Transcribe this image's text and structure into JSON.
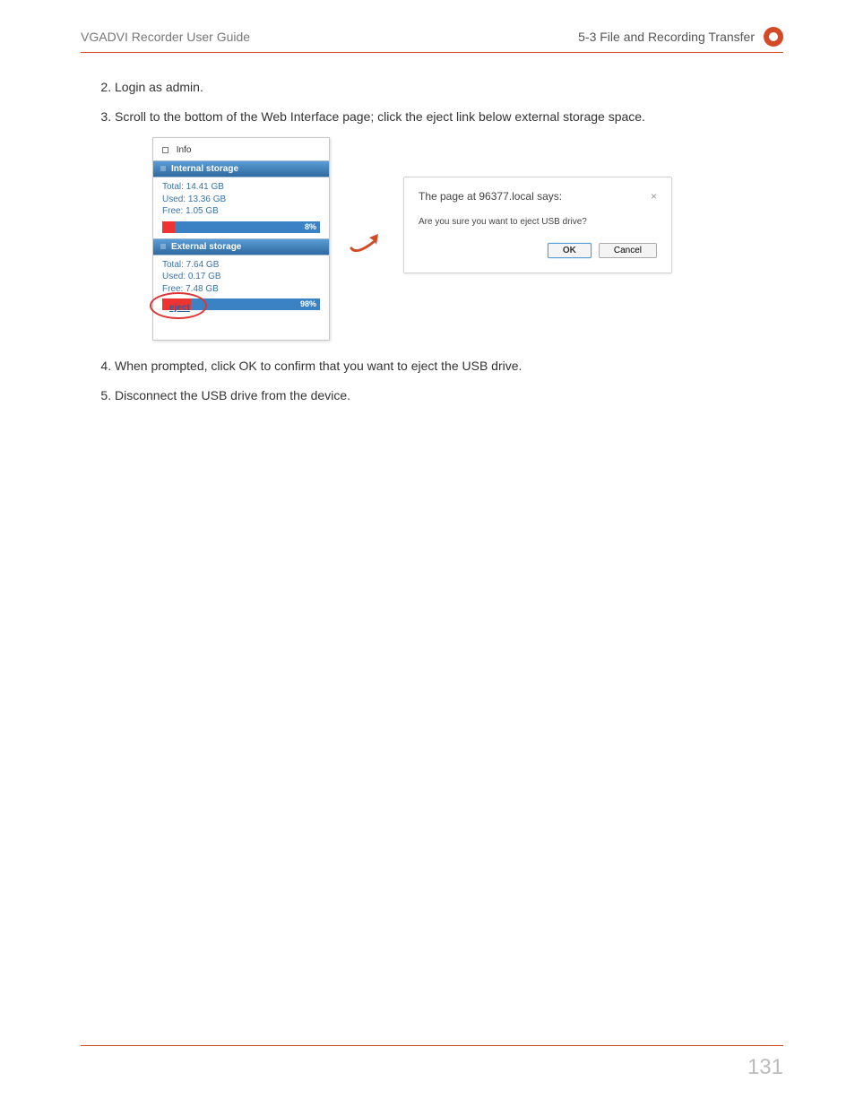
{
  "header": {
    "left": "VGADVI Recorder User Guide",
    "right": "5-3 File and Recording Transfer"
  },
  "steps": [
    {
      "num": "2.",
      "text": "Login as admin."
    },
    {
      "num": "3.",
      "text": "Scroll to the bottom of the Web Interface page; click the eject link below external storage space."
    },
    {
      "num": "4.",
      "text": "When prompted, click OK to confirm that you want to eject the USB drive."
    },
    {
      "num": "5.",
      "text": "Disconnect the USB drive from the device."
    }
  ],
  "panel": {
    "info_label": "Info",
    "internal_header": "Internal storage",
    "internal_total": "Total: 14.41 GB",
    "internal_used": "Used: 13.36 GB",
    "internal_free": "Free: 1.05 GB",
    "internal_bar_label": "8%",
    "internal_fill_pct": 8,
    "external_header": "External storage",
    "external_total": "Total: 7.64 GB",
    "external_used": "Used: 0.17 GB",
    "external_free": "Free: 7.48 GB",
    "external_bar_label": "98%",
    "external_fill_pct": 18,
    "eject_label": "eject"
  },
  "dialog": {
    "title": "The page at 96377.local says:",
    "close": "×",
    "message": "Are you sure you want to eject USB drive?",
    "ok": "OK",
    "cancel": "Cancel"
  },
  "footer": {
    "page_number": "131"
  }
}
